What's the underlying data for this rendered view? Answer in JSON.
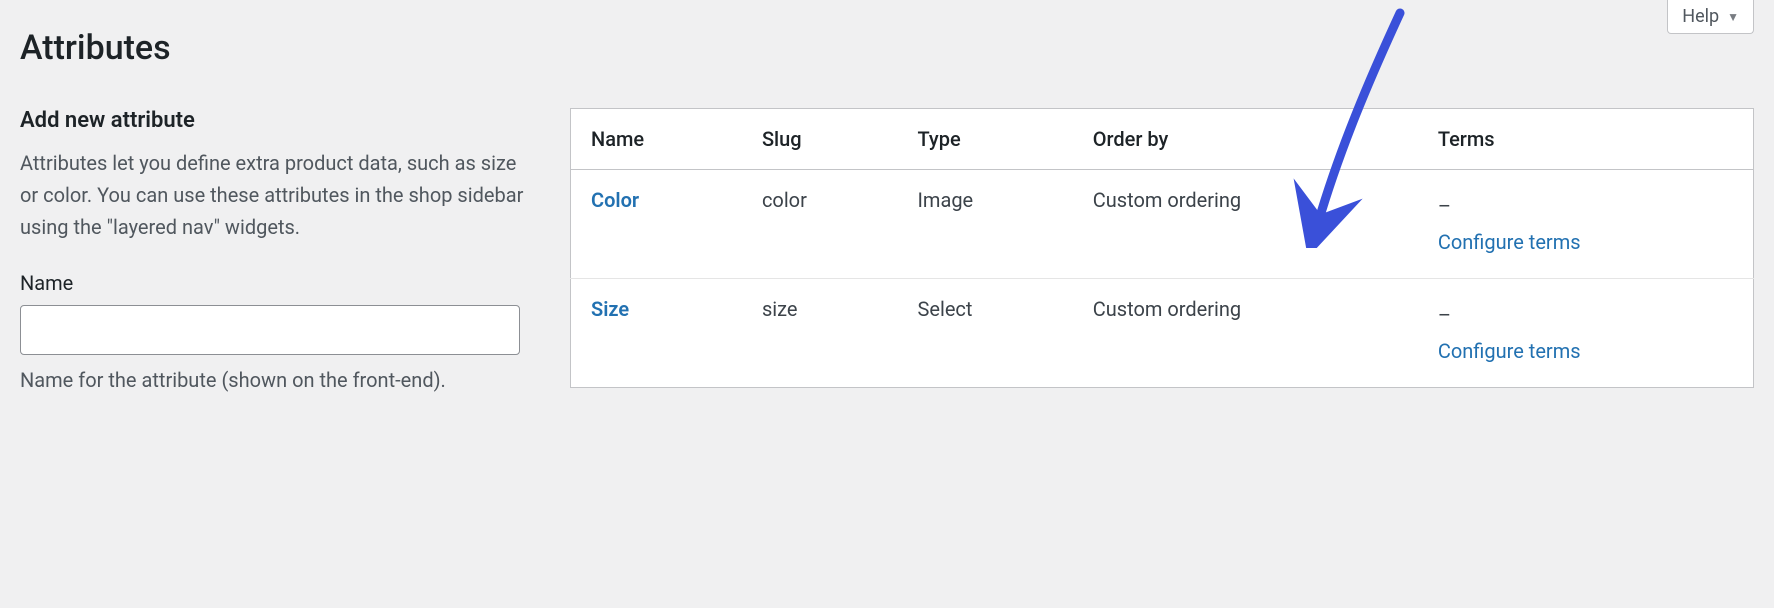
{
  "help": {
    "label": "Help"
  },
  "page": {
    "title": "Attributes"
  },
  "form": {
    "heading": "Add new attribute",
    "description": "Attributes let you define extra product data, such as size or color. You can use these attributes in the shop sidebar using the \"layered nav\" widgets.",
    "name_label": "Name",
    "name_value": "",
    "name_hint": "Name for the attribute (shown on the front-end)."
  },
  "table": {
    "headers": {
      "name": "Name",
      "slug": "Slug",
      "type": "Type",
      "order_by": "Order by",
      "terms": "Terms"
    },
    "rows": [
      {
        "name": "Color",
        "slug": "color",
        "type": "Image",
        "order_by": "Custom ordering",
        "terms_placeholder": "–",
        "configure_label": "Configure terms"
      },
      {
        "name": "Size",
        "slug": "size",
        "type": "Select",
        "order_by": "Custom ordering",
        "terms_placeholder": "–",
        "configure_label": "Configure terms"
      }
    ]
  }
}
